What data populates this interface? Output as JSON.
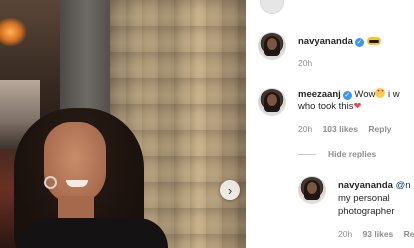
{
  "post": {
    "next_icon": "chevron-right-icon"
  },
  "comments": [
    {
      "username": "navyananda",
      "verified": true,
      "text": "",
      "time": "20h",
      "emoji": "sunglasses"
    },
    {
      "username": "meezaanj",
      "verified": true,
      "text_line1": "Wow",
      "text_line1_tail": "i w",
      "text_line2": "who took this",
      "time": "20h",
      "likes": "103 likes",
      "reply": "Reply"
    }
  ],
  "hide_replies": "Hide replies",
  "reply_comment": {
    "username": "navyananda",
    "mention": "@n",
    "text_line1": "my personal",
    "text_line2": "photographer",
    "time": "20h",
    "likes": "93 likes",
    "reply": "Reply"
  }
}
